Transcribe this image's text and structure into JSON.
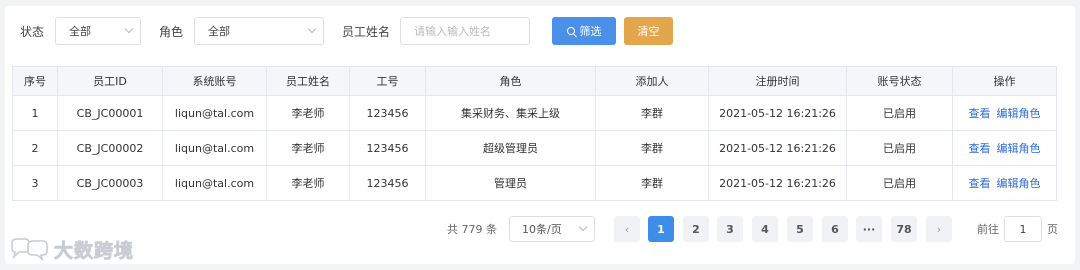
{
  "filters": {
    "status_label": "状态",
    "status_value": "全部",
    "role_label": "角色",
    "role_value": "全部",
    "name_label": "员工姓名",
    "name_placeholder": "请输入输入姓名",
    "filter_button": "筛选",
    "clear_button": "清空"
  },
  "table": {
    "headers": [
      "序号",
      "员工ID",
      "系统账号",
      "员工姓名",
      "工号",
      "角色",
      "添加人",
      "注册时间",
      "账号状态",
      "操作"
    ],
    "rows": [
      {
        "index": "1",
        "employee_id": "CB_JC00001",
        "account": "liqun@tal.com",
        "name": "李老师",
        "job_no": "123456",
        "role": "集采财务、集采上级",
        "added_by": "李群",
        "registered": "2021-05-12 16:21:26",
        "status": "已启用",
        "view": "查看",
        "edit_role": "编辑角色"
      },
      {
        "index": "2",
        "employee_id": "CB_JC00002",
        "account": "liqun@tal.com",
        "name": "李老师",
        "job_no": "123456",
        "role": "超级管理员",
        "added_by": "李群",
        "registered": "2021-05-12 16:21:26",
        "status": "已启用",
        "view": "查看",
        "edit_role": "编辑角色"
      },
      {
        "index": "3",
        "employee_id": "CB_JC00003",
        "account": "liqun@tal.com",
        "name": "李老师",
        "job_no": "123456",
        "role": "管理员",
        "added_by": "李群",
        "registered": "2021-05-12 16:21:26",
        "status": "已启用",
        "view": "查看",
        "edit_role": "编辑角色"
      }
    ]
  },
  "pagination": {
    "total": "共 779 条",
    "page_size": "10条/页",
    "prev": "‹",
    "pages": [
      "1",
      "2",
      "3",
      "4",
      "5",
      "6",
      "···",
      "78"
    ],
    "active_page": "1",
    "next": "›",
    "goto_label": "前往",
    "goto_value": "1",
    "goto_unit": "页"
  },
  "watermark": {
    "text": "大数跨境"
  }
}
